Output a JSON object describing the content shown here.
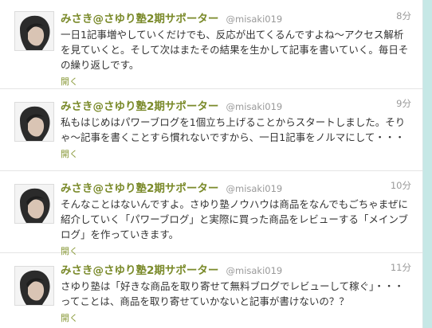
{
  "tweets": [
    {
      "name": "みさき@さゆり塾2期サポーター",
      "handle": "@misaki019",
      "time": "8分",
      "text": "一日1記事増やしていくだけでも、反応が出てくるんですよね〜アクセス解析を見ていくと。そして次はまたその結果を生かして記事を書いていく。毎日その繰り返しです。",
      "open": "開く"
    },
    {
      "name": "みさき@さゆり塾2期サポーター",
      "handle": "@misaki019",
      "time": "9分",
      "text": "私もはじめはパワーブログを1個立ち上げることからスタートしました。そりゃ〜記事を書くことすら慣れないですから、一日1記事をノルマにして・・・",
      "open": "開く"
    },
    {
      "name": "みさき@さゆり塾2期サポーター",
      "handle": "@misaki019",
      "time": "10分",
      "text": "そんなことはないんですよ。さゆり塾ノウハウは商品をなんでもごちゃまぜに紹介していく「パワーブログ」と実際に買った商品をレビューする「メインブログ」を作っていきます。",
      "open": "開く"
    },
    {
      "name": "みさき@さゆり塾2期サポーター",
      "handle": "@misaki019",
      "time": "11分",
      "text": "さゆり塾は「好きな商品を取り寄せて無料ブログでレビューして稼ぐ」・・・ってことは、商品を取り寄せていかないと記事が書けないの？？",
      "open": "開く"
    }
  ]
}
